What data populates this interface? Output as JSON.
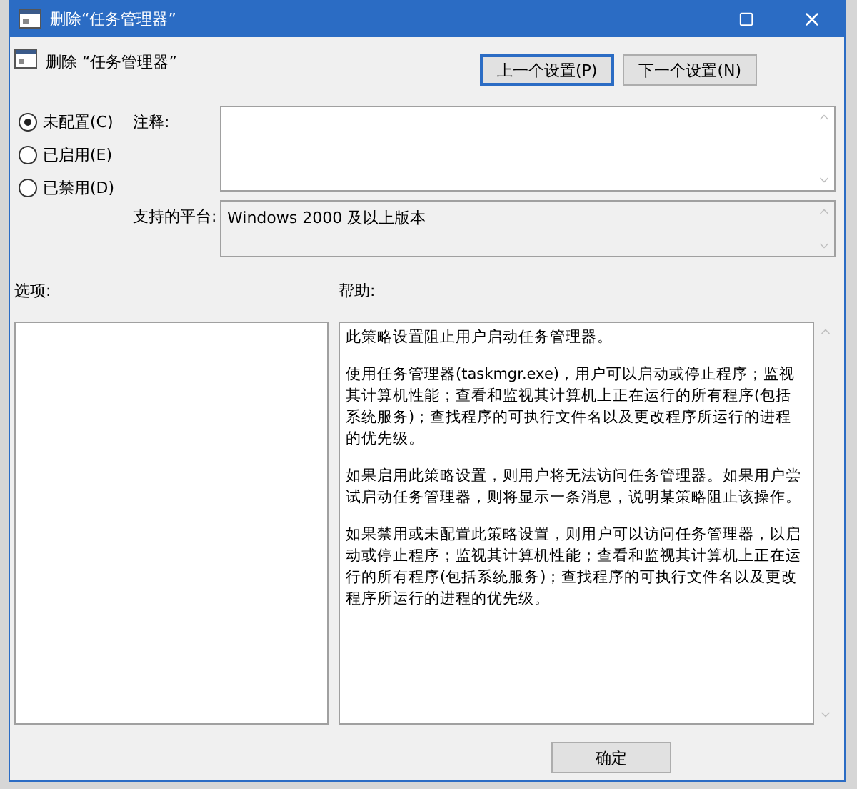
{
  "window": {
    "title": "删除“任务管理器”"
  },
  "header": {
    "title": "删除 “任务管理器”"
  },
  "nav_buttons": [
    {
      "label": "上一个设置(P)",
      "selected": true
    },
    {
      "label": "下一个设置(N)",
      "selected": false
    }
  ],
  "options_state": [
    {
      "label": "未配置(C)",
      "selected": true
    },
    {
      "label": "已启用(E)",
      "selected": false
    },
    {
      "label": "已禁用(D)",
      "selected": false
    }
  ],
  "comment": {
    "label": "注释:"
  },
  "platform": {
    "label": "支持的平台:",
    "value": "Windows 2000 及以上版本"
  },
  "options": {
    "label": "选项:"
  },
  "help": {
    "label": "帮助:",
    "paragraphs": [
      "此策略设置阻止用户启动任务管理器。",
      "使用任务管理器(taskmgr.exe)，用户可以启动或停止程序；监视其计算机性能；查看和监视其计算机上正在运行的所有程序(包括系统服务)；查找程序的可执行文件名以及更改程序所运行的进程的优先级。",
      "如果启用此策略设置，则用户将无法访问任务管理器。如果用户尝试启动任务管理器，则将显示一条消息，说明某策略阻止该操作。",
      "如果禁用或未配置此策略设置，则用户可以访问任务管理器，以启动或停止程序；监视其计算机性能；查看和监视其计算机上正在运行的所有程序(包括系统服务)；查找程序的可执行文件名以及更改程序所运行的进程的优先级。"
    ]
  },
  "buttons": [
    {
      "label": "确定"
    }
  ]
}
